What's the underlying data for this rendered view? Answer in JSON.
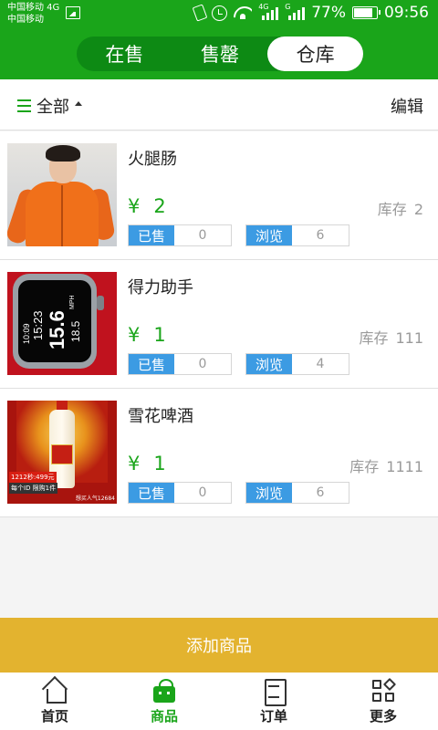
{
  "status_bar": {
    "carrier_1": "中国移动 4G",
    "carrier_2": "中国移动",
    "network_1": "4G",
    "network_2": "G",
    "battery": "77%",
    "time": "09:56"
  },
  "header": {
    "tabs": [
      {
        "label": "在售",
        "active": false
      },
      {
        "label": "售罄",
        "active": false
      },
      {
        "label": "仓库",
        "active": true
      }
    ]
  },
  "filter": {
    "label": "全部",
    "edit_label": "编辑"
  },
  "labels": {
    "currency": "¥",
    "stock": "库存",
    "sold": "已售",
    "views": "浏览"
  },
  "products": [
    {
      "name": "火腿肠",
      "price": "2",
      "stock": "2",
      "sold": "0",
      "views": "6",
      "image": "orange-jacket-photo"
    },
    {
      "name": "得力助手",
      "price": "1",
      "stock": "111",
      "sold": "0",
      "views": "4",
      "image": "smartwatch-photo"
    },
    {
      "name": "雪花啤酒",
      "price": "1",
      "stock": "1111",
      "sold": "0",
      "views": "6",
      "image": "liquor-bottle-photo"
    }
  ],
  "watch_screen": {
    "t1": "10:09",
    "t2": "15:23",
    "t3": "15.6",
    "t4": "18.5",
    "unit": "MPH"
  },
  "beer_image": {
    "promo_1": "1212秒:499元",
    "promo_2": "每个ID 限购1件",
    "corner": "想买人气12684"
  },
  "add_button": "添加商品",
  "bottom_nav": [
    {
      "label": "首页",
      "icon": "home-icon",
      "active": false
    },
    {
      "label": "商品",
      "icon": "bag-icon",
      "active": true
    },
    {
      "label": "订单",
      "icon": "order-icon",
      "active": false
    },
    {
      "label": "更多",
      "icon": "more-icon",
      "active": false
    }
  ],
  "colors": {
    "brand_green": "#1aa51a",
    "tag_blue": "#3c9be3",
    "add_yellow": "#e3b32f"
  }
}
